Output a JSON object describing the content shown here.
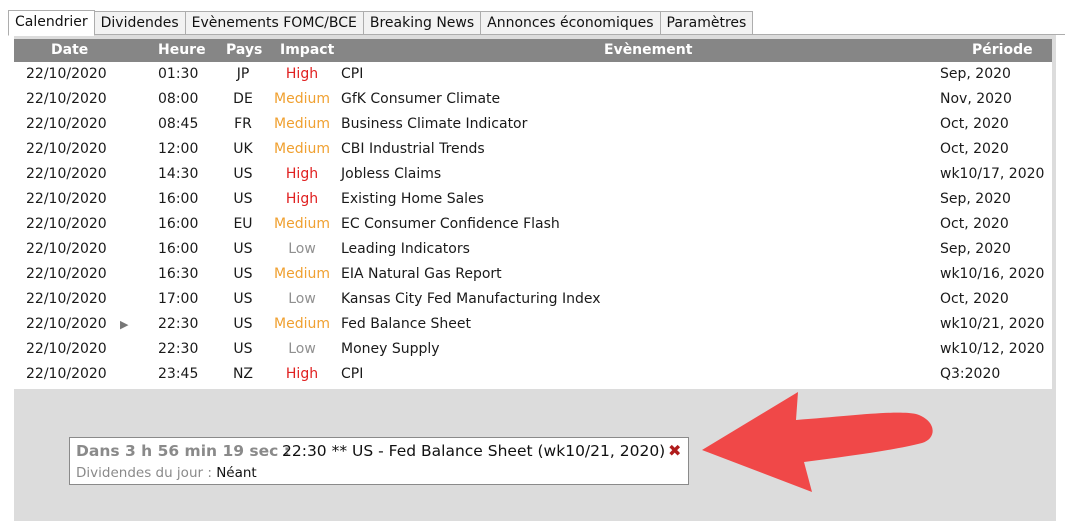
{
  "tabs": [
    "Calendrier",
    "Dividendes",
    "Evènements FOMC/BCE",
    "Breaking News",
    "Annonces économiques",
    "Paramètres"
  ],
  "active_tab": "Calendrier",
  "table": {
    "headers": {
      "date": "Date",
      "heure": "Heure",
      "pays": "Pays",
      "impact": "Impact",
      "evenement": "Evènement",
      "periode": "Période"
    },
    "rows": [
      {
        "date": "22/10/2020",
        "heure": "01:30",
        "pays": "JP",
        "impact": "High",
        "evenement": "CPI",
        "periode": "Sep, 2020"
      },
      {
        "date": "22/10/2020",
        "heure": "08:00",
        "pays": "DE",
        "impact": "Medium",
        "evenement": "GfK Consumer Climate",
        "periode": "Nov, 2020"
      },
      {
        "date": "22/10/2020",
        "heure": "08:45",
        "pays": "FR",
        "impact": "Medium",
        "evenement": "Business Climate Indicator",
        "periode": "Oct, 2020"
      },
      {
        "date": "22/10/2020",
        "heure": "12:00",
        "pays": "UK",
        "impact": "Medium",
        "evenement": "CBI Industrial Trends",
        "periode": "Oct, 2020"
      },
      {
        "date": "22/10/2020",
        "heure": "14:30",
        "pays": "US",
        "impact": "High",
        "evenement": "Jobless Claims",
        "periode": "wk10/17, 2020"
      },
      {
        "date": "22/10/2020",
        "heure": "16:00",
        "pays": "US",
        "impact": "High",
        "evenement": "Existing Home Sales",
        "periode": "Sep, 2020"
      },
      {
        "date": "22/10/2020",
        "heure": "16:00",
        "pays": "EU",
        "impact": "Medium",
        "evenement": "EC Consumer Confidence Flash",
        "periode": "Oct, 2020"
      },
      {
        "date": "22/10/2020",
        "heure": "16:00",
        "pays": "US",
        "impact": "Low",
        "evenement": "Leading Indicators",
        "periode": "Sep, 2020"
      },
      {
        "date": "22/10/2020",
        "heure": "16:30",
        "pays": "US",
        "impact": "Medium",
        "evenement": "EIA Natural Gas Report",
        "periode": "wk10/16, 2020"
      },
      {
        "date": "22/10/2020",
        "heure": "17:00",
        "pays": "US",
        "impact": "Low",
        "evenement": "Kansas City Fed Manufacturing Index",
        "periode": "Oct, 2020"
      },
      {
        "date": "22/10/2020",
        "heure": "22:30",
        "pays": "US",
        "impact": "Medium",
        "evenement": "Fed Balance Sheet",
        "periode": "wk10/21, 2020",
        "current": true
      },
      {
        "date": "22/10/2020",
        "heure": "22:30",
        "pays": "US",
        "impact": "Low",
        "evenement": "Money Supply",
        "periode": "wk10/12, 2020"
      },
      {
        "date": "22/10/2020",
        "heure": "23:45",
        "pays": "NZ",
        "impact": "High",
        "evenement": "CPI",
        "periode": "Q3:2020"
      }
    ]
  },
  "notification": {
    "countdown": "Dans 3 h 56 min 19 sec  :",
    "event": "22:30 ** US - Fed Balance Sheet (wk10/21, 2020)",
    "dividends_label": "Dividendes du jour :",
    "dividends_value": "Néant",
    "close_icon": "close-x-icon"
  },
  "current_row_icon": "play-triangle-icon",
  "colors": {
    "high": "#e02020",
    "medium": "#f0a030",
    "low": "#909090",
    "header_bg": "#868686",
    "panel_bg": "#dcdcdc",
    "close": "#b01c1c",
    "annotation_arrow": "#f04848"
  }
}
